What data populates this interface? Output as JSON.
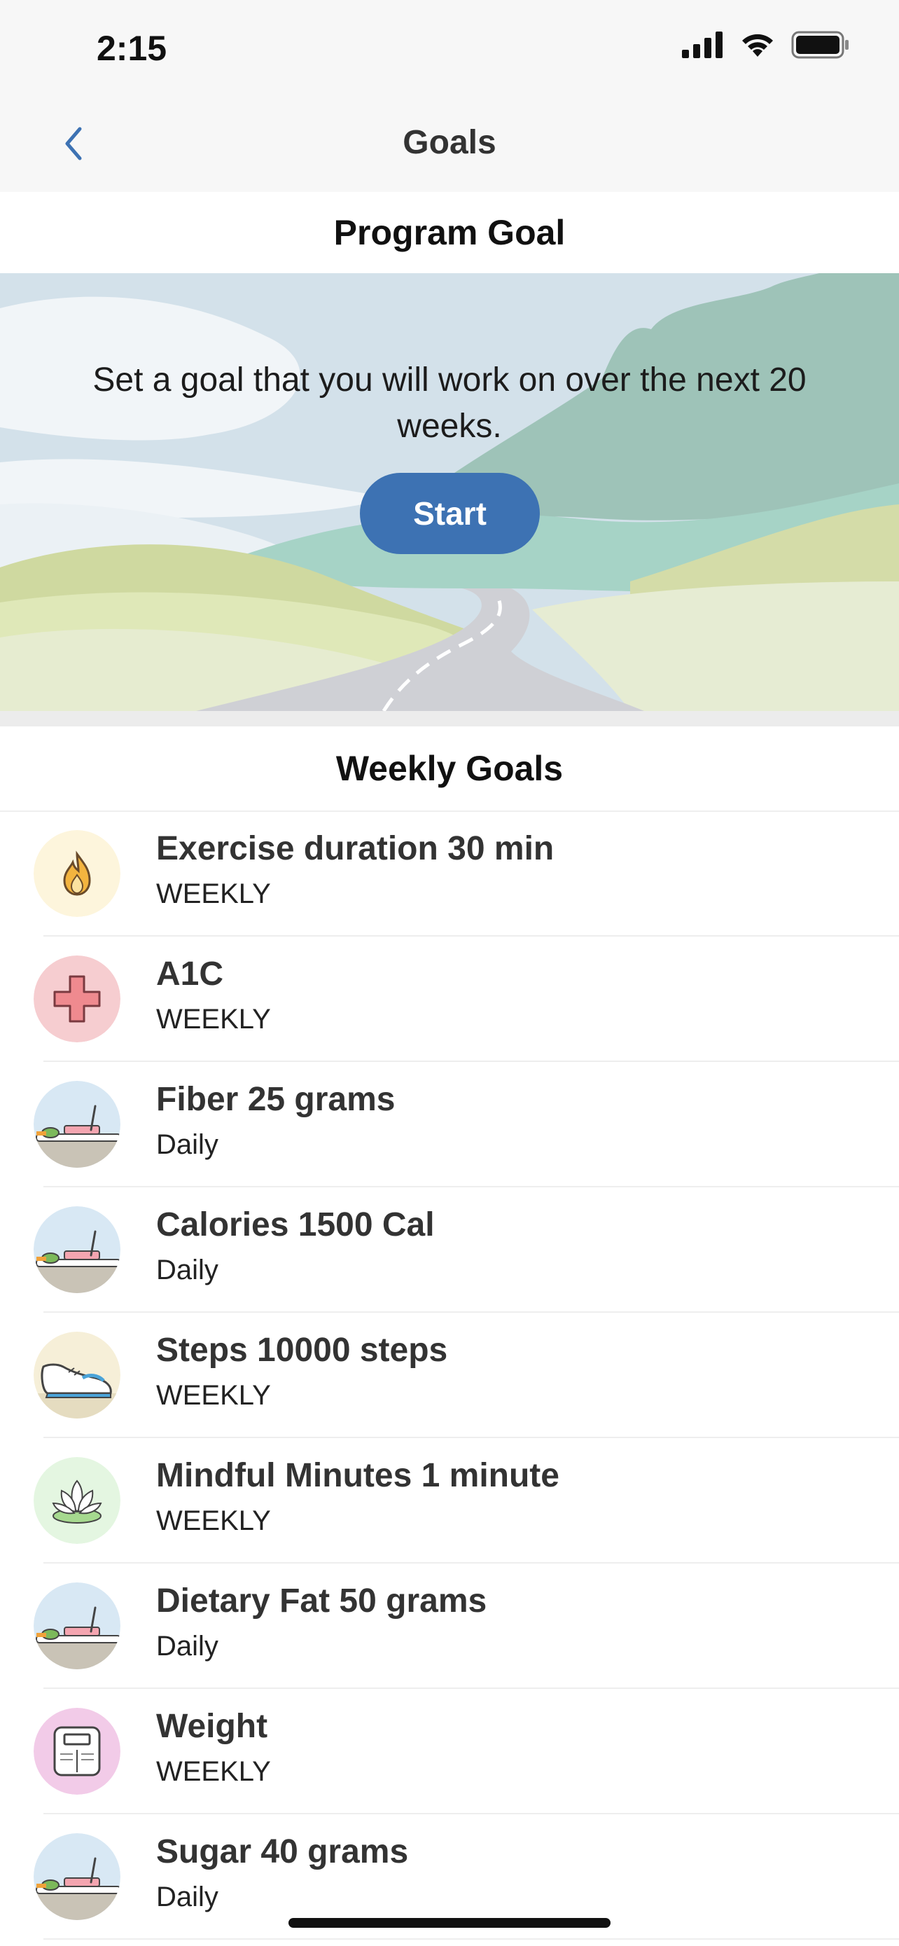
{
  "status_bar": {
    "time": "2:15",
    "icons": [
      "cellular-signal-icon",
      "wifi-icon",
      "battery-icon"
    ]
  },
  "nav": {
    "title": "Goals",
    "back_icon": "chevron-left-icon"
  },
  "program_goal": {
    "header": "Program Goal",
    "text": "Set a goal that you will work on over the next 20 weeks.",
    "button_label": "Start"
  },
  "weekly_goals": {
    "header": "Weekly Goals",
    "items": [
      {
        "title": "Exercise duration 30 min",
        "frequency": "WEEKLY",
        "icon": "flame-icon"
      },
      {
        "title": "A1C",
        "frequency": "WEEKLY",
        "icon": "medical-cross-icon"
      },
      {
        "title": "Fiber 25 grams",
        "frequency": "Daily",
        "icon": "food-plate-icon"
      },
      {
        "title": "Calories 1500 Cal",
        "frequency": "Daily",
        "icon": "food-plate-icon"
      },
      {
        "title": "Steps 10000 steps",
        "frequency": "WEEKLY",
        "icon": "sneaker-icon"
      },
      {
        "title": "Mindful Minutes 1 minute",
        "frequency": "WEEKLY",
        "icon": "lotus-icon"
      },
      {
        "title": "Dietary Fat 50 grams",
        "frequency": "Daily",
        "icon": "food-plate-icon"
      },
      {
        "title": "Weight",
        "frequency": "WEEKLY",
        "icon": "scale-icon"
      },
      {
        "title": "Sugar 40 grams",
        "frequency": "Daily",
        "icon": "food-plate-icon"
      }
    ]
  },
  "colors": {
    "accent": "#3d72b3",
    "nav_bg": "#f7f7f7"
  }
}
